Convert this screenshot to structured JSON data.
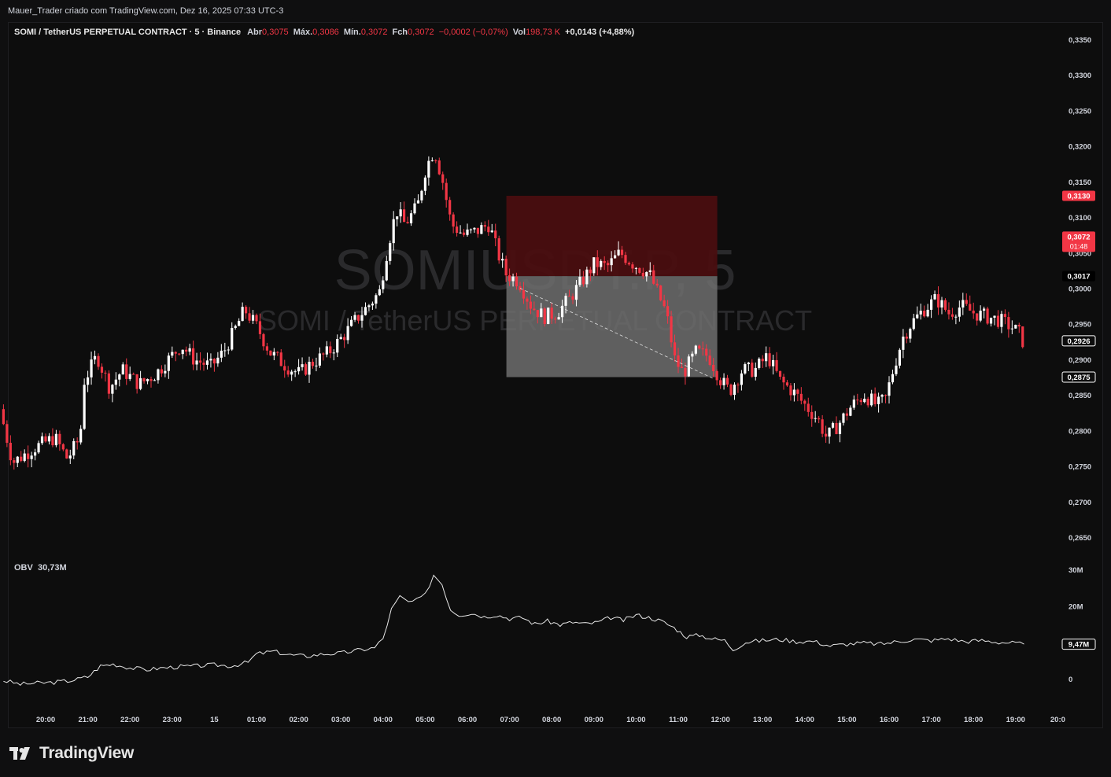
{
  "header": {
    "author_line": "Mauer_Trader criado com TradingView.com, Dez 16, 2025 07:33 UTC-3"
  },
  "legend": {
    "symbol": "SOMI / TetherUS PERPETUAL CONTRACT · 5 · Binance",
    "open_label": "Abr",
    "open": "0,3075",
    "high_label": "Máx.",
    "high": "0,3086",
    "low_label": "Mín.",
    "low": "0,3072",
    "close_label": "Fch",
    "close": "0,3072",
    "change": "−0,0002 (−0,07%)",
    "vol_label": "Vol",
    "vol": "198,73 K",
    "day_change": "+0,0143 (+4,88%)"
  },
  "watermark": {
    "line1": "SOMIUSDT.P, 5",
    "line2": "SOMI / TetherUS PERPETUAL CONTRACT"
  },
  "obv_legend": {
    "label": "OBV",
    "value": "30,73M"
  },
  "brand": {
    "name": "TradingView"
  },
  "colors": {
    "background": "#0d0d0d",
    "up_candle": "#ffffff",
    "down_candle": "#f23645",
    "stop_zone": "#4a0e10",
    "target_zone": "#6e6e6e",
    "obv_line": "#e8e8e8"
  },
  "chart_data": [
    {
      "type": "candlestick",
      "title": "SOMI / TetherUS PERPETUAL CONTRACT · 5 · Binance",
      "x_ticks": [
        "20:00",
        "21:00",
        "22:00",
        "23:00",
        "15",
        "01:00",
        "02:00",
        "03:00",
        "04:00",
        "05:00",
        "06:00",
        "07:00",
        "08:00",
        "09:00",
        "10:00",
        "11:00",
        "12:00",
        "13:00",
        "14:00",
        "15:00",
        "16:00",
        "17:00",
        "18:00",
        "19:00",
        "20:0"
      ],
      "y_ticks": [
        "0,3350",
        "0,3300",
        "0,3250",
        "0,3200",
        "0,3150",
        "0,3100",
        "0,3050",
        "0,3000",
        "0,2950",
        "0,2900",
        "0,2850",
        "0,2800",
        "0,2750",
        "0,2700",
        "0,2650"
      ],
      "ylim": [
        0.2615,
        0.3368
      ],
      "price_labels": [
        {
          "text": "0,3130",
          "value": 0.313,
          "style": "red"
        },
        {
          "text": "0,3072",
          "value": 0.3072,
          "style": "red",
          "subtext": "01:48"
        },
        {
          "text": "0,3017",
          "value": 0.3017,
          "style": "dark"
        },
        {
          "text": "0,2926",
          "value": 0.2926,
          "style": "light"
        },
        {
          "text": "0,2875",
          "value": 0.2875,
          "style": "light"
        }
      ],
      "position_tool": {
        "x_start": "07:00",
        "x_end": "12:00",
        "entry": 0.3017,
        "stop": 0.313,
        "target": 0.2875
      },
      "trend_line": [
        {
          "x": "07:15",
          "y": 0.3
        },
        {
          "x": "11:50",
          "y": 0.2873
        }
      ],
      "price_path": [
        [
          19.0,
          0.283
        ],
        [
          19.3,
          0.2755
        ],
        [
          19.8,
          0.2775
        ],
        [
          20.3,
          0.279
        ],
        [
          20.6,
          0.276
        ],
        [
          20.9,
          0.279
        ],
        [
          21.0,
          0.287
        ],
        [
          21.3,
          0.2905
        ],
        [
          21.6,
          0.286
        ],
        [
          21.9,
          0.2885
        ],
        [
          22.3,
          0.2865
        ],
        [
          22.7,
          0.288
        ],
        [
          23.0,
          0.29
        ],
        [
          23.3,
          0.292
        ],
        [
          23.6,
          0.29
        ],
        [
          24.0,
          0.289
        ],
        [
          24.3,
          0.291
        ],
        [
          24.6,
          0.2945
        ],
        [
          24.8,
          0.297
        ],
        [
          25.1,
          0.2945
        ],
        [
          25.4,
          0.291
        ],
        [
          25.8,
          0.289
        ],
        [
          26.1,
          0.288
        ],
        [
          26.4,
          0.2895
        ],
        [
          26.8,
          0.291
        ],
        [
          27.1,
          0.293
        ],
        [
          27.5,
          0.296
        ],
        [
          27.8,
          0.298
        ],
        [
          28.0,
          0.2995
        ],
        [
          28.2,
          0.306
        ],
        [
          28.4,
          0.311
        ],
        [
          28.6,
          0.309
        ],
        [
          28.9,
          0.3115
        ],
        [
          29.1,
          0.317
        ],
        [
          29.3,
          0.3195
        ],
        [
          29.5,
          0.315
        ],
        [
          29.7,
          0.309
        ],
        [
          30.0,
          0.3075
        ],
        [
          30.3,
          0.308
        ],
        [
          30.6,
          0.309
        ],
        [
          30.8,
          0.305
        ],
        [
          31.0,
          0.302
        ],
        [
          31.3,
          0.301
        ],
        [
          31.6,
          0.2975
        ],
        [
          31.9,
          0.296
        ],
        [
          32.2,
          0.2965
        ],
        [
          32.5,
          0.2985
        ],
        [
          32.8,
          0.301
        ],
        [
          33.1,
          0.3035
        ],
        [
          33.4,
          0.303
        ],
        [
          33.7,
          0.305
        ],
        [
          34.0,
          0.3035
        ],
        [
          34.4,
          0.302
        ],
        [
          34.8,
          0.2965
        ],
        [
          35.0,
          0.29
        ],
        [
          35.2,
          0.288
        ],
        [
          35.5,
          0.291
        ],
        [
          35.8,
          0.2905
        ],
        [
          36.1,
          0.287
        ],
        [
          36.3,
          0.2855
        ],
        [
          36.6,
          0.2885
        ],
        [
          36.9,
          0.2885
        ],
        [
          37.2,
          0.2905
        ],
        [
          37.5,
          0.287
        ],
        [
          37.8,
          0.2855
        ],
        [
          38.1,
          0.2835
        ],
        [
          38.4,
          0.2815
        ],
        [
          38.6,
          0.279
        ],
        [
          38.9,
          0.281
        ],
        [
          39.2,
          0.2835
        ],
        [
          39.5,
          0.285
        ],
        [
          39.8,
          0.2835
        ],
        [
          40.0,
          0.2845
        ],
        [
          40.2,
          0.289
        ],
        [
          40.4,
          0.293
        ],
        [
          40.6,
          0.295
        ],
        [
          40.9,
          0.297
        ],
        [
          41.2,
          0.2985
        ],
        [
          41.5,
          0.2965
        ],
        [
          41.8,
          0.2975
        ],
        [
          42.1,
          0.2965
        ],
        [
          42.4,
          0.296
        ],
        [
          42.7,
          0.2955
        ],
        [
          43.0,
          0.2945
        ],
        [
          43.2,
          0.2935
        ],
        [
          43.2,
          0.2926
        ]
      ]
    },
    {
      "type": "line",
      "title": "OBV",
      "series": [
        {
          "name": "OBV",
          "values": []
        }
      ],
      "y_ticks": [
        "30M",
        "20M",
        "0"
      ],
      "ylim": [
        -3.5,
        32.5
      ],
      "last_label": "9,47M",
      "obv_path": [
        [
          19.0,
          -0.5
        ],
        [
          19.4,
          -1.5
        ],
        [
          19.8,
          -1.2
        ],
        [
          20.2,
          -1.0
        ],
        [
          20.6,
          -0.5
        ],
        [
          21.0,
          0.5
        ],
        [
          21.3,
          3.5
        ],
        [
          21.6,
          4.0
        ],
        [
          22.0,
          3.0
        ],
        [
          22.4,
          2.5
        ],
        [
          22.8,
          3.0
        ],
        [
          23.2,
          3.3
        ],
        [
          23.6,
          3.5
        ],
        [
          24.0,
          3.8
        ],
        [
          24.4,
          3.5
        ],
        [
          24.8,
          4.5
        ],
        [
          25.0,
          6.8
        ],
        [
          25.4,
          7.5
        ],
        [
          25.8,
          6.5
        ],
        [
          26.2,
          6.2
        ],
        [
          26.6,
          6.8
        ],
        [
          27.0,
          7.0
        ],
        [
          27.4,
          7.8
        ],
        [
          27.8,
          8.5
        ],
        [
          28.0,
          11.0
        ],
        [
          28.2,
          19.0
        ],
        [
          28.4,
          22.5
        ],
        [
          28.6,
          21.0
        ],
        [
          28.8,
          21.5
        ],
        [
          29.0,
          23.0
        ],
        [
          29.2,
          28.5
        ],
        [
          29.4,
          26.0
        ],
        [
          29.6,
          19.0
        ],
        [
          29.8,
          17.5
        ],
        [
          30.1,
          18.0
        ],
        [
          30.4,
          17.0
        ],
        [
          30.7,
          17.5
        ],
        [
          31.0,
          16.5
        ],
        [
          31.3,
          16.8
        ],
        [
          31.6,
          15.0
        ],
        [
          31.9,
          15.8
        ],
        [
          32.2,
          14.8
        ],
        [
          32.5,
          15.5
        ],
        [
          32.8,
          15.0
        ],
        [
          33.1,
          15.5
        ],
        [
          33.4,
          16.8
        ],
        [
          33.7,
          16.0
        ],
        [
          34.0,
          17.5
        ],
        [
          34.3,
          16.8
        ],
        [
          34.6,
          15.8
        ],
        [
          34.9,
          14.0
        ],
        [
          35.2,
          11.5
        ],
        [
          35.5,
          12.0
        ],
        [
          35.8,
          11.0
        ],
        [
          36.1,
          10.5
        ],
        [
          36.3,
          8.0
        ],
        [
          36.6,
          10.0
        ],
        [
          37.0,
          10.5
        ],
        [
          37.4,
          10.8
        ],
        [
          37.8,
          10.2
        ],
        [
          38.2,
          10.3
        ],
        [
          38.6,
          9.0
        ],
        [
          39.0,
          9.5
        ],
        [
          39.4,
          9.8
        ],
        [
          39.8,
          9.5
        ],
        [
          40.2,
          10.2
        ],
        [
          40.6,
          10.8
        ],
        [
          41.0,
          10.5
        ],
        [
          41.4,
          11.0
        ],
        [
          41.8,
          10.2
        ],
        [
          42.2,
          10.5
        ],
        [
          42.6,
          10.0
        ],
        [
          43.0,
          9.8
        ],
        [
          43.2,
          9.47
        ]
      ]
    }
  ]
}
